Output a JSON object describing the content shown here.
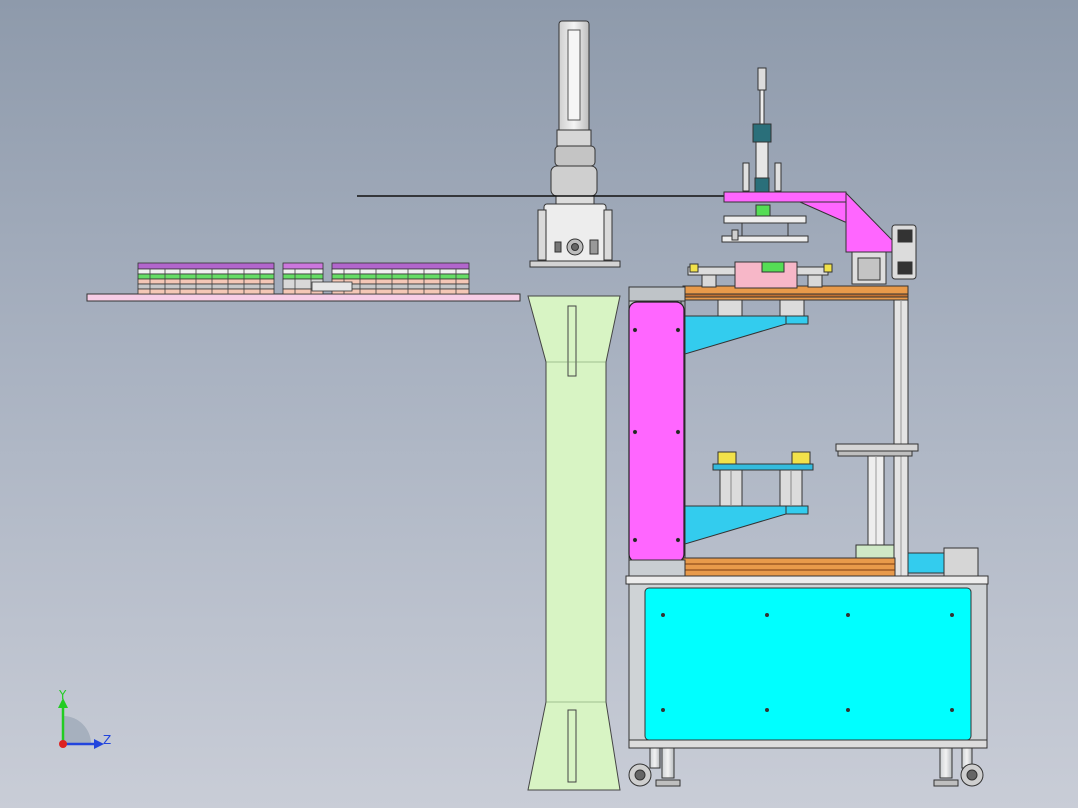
{
  "view": {
    "background_top": "#8e9aab",
    "background_bottom": "#c9cdd7"
  },
  "triad": {
    "y_label": "Y",
    "z_label": "Z",
    "y_color": "#22cc22",
    "z_color": "#2244dd",
    "x_color": "#dd2222"
  },
  "colors": {
    "pillar": "#d8f4c4",
    "frame_panel": "#00ffff",
    "cover_magenta": "#ff66ff",
    "bracket_cyan": "#33ccee",
    "deck_orange": "#e89a4a",
    "conveyor_plate": "#f7cde6",
    "robot_body": "#e8e8e8"
  }
}
